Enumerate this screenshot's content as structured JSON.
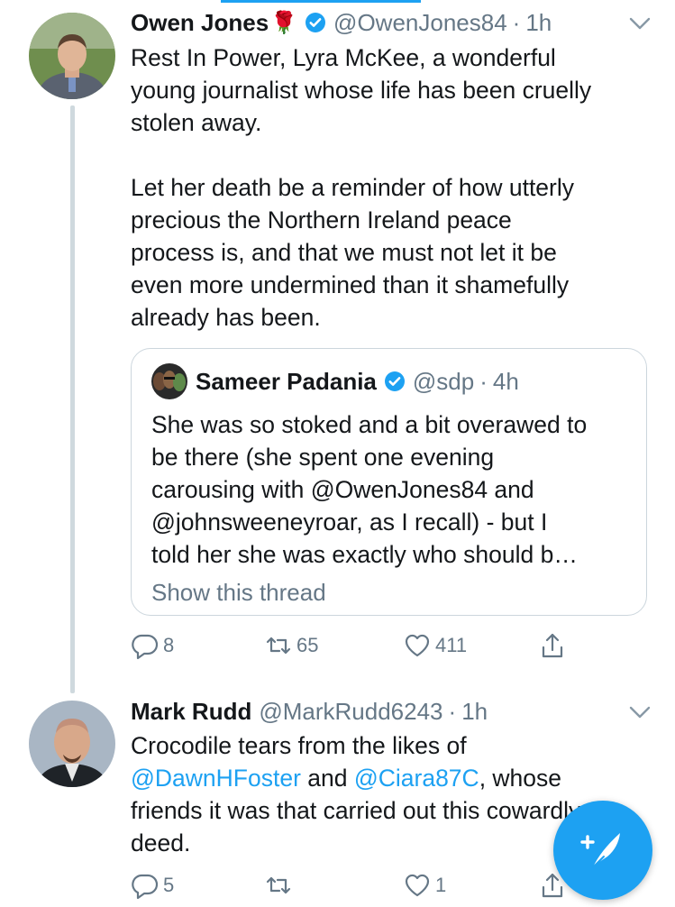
{
  "colors": {
    "accent": "#1da1f2",
    "muted": "#657786",
    "text": "#14171a",
    "border": "#ccd6dd"
  },
  "tweets": [
    {
      "author": "Owen Jones",
      "emoji": "🌹",
      "handle": "@OwenJones84",
      "dot": "·",
      "time": "1h",
      "body": "Rest In Power, Lyra McKee, a wonderful\nyoung journalist whose life has been cruelly\nstolen away.\n\nLet her death be a reminder of how utterly\nprecious the Northern Ireland peace\nprocess is, and that we must not let it be\neven more undermined than it shamefully\nalready has been.",
      "quote": {
        "author": "Sameer Padania",
        "handle": "@sdp",
        "dot": "·",
        "time": "4h",
        "body": "She was so stoked and a bit overawed to\nbe there (she spent one evening\ncarousing with @OwenJones84 and\n@johnsweeneyroar, as I recall) - but I\ntold her she was exactly who should b…",
        "show_thread": "Show this thread"
      },
      "replies": "8",
      "retweets": "65",
      "likes": "411"
    },
    {
      "author": "Mark Rudd",
      "handle": "@MarkRudd6243",
      "dot": "·",
      "time": "1h",
      "body_line1": "Crocodile tears from the likes of",
      "mention1": "@DawnHFoster",
      "and": " and ",
      "mention2": "@Ciara87C",
      "after_mentions": ", whose",
      "body_line3": "friends it was that carried out this cowardly",
      "body_line4": "deed.",
      "replies": "5",
      "retweets": "",
      "likes": "1"
    }
  ],
  "icons": {
    "verified": "verified-badge-icon",
    "caret": "chevron-down-icon",
    "reply": "reply-icon",
    "retweet": "retweet-icon",
    "like": "heart-icon",
    "share": "share-icon",
    "compose": "compose-tweet-icon"
  }
}
